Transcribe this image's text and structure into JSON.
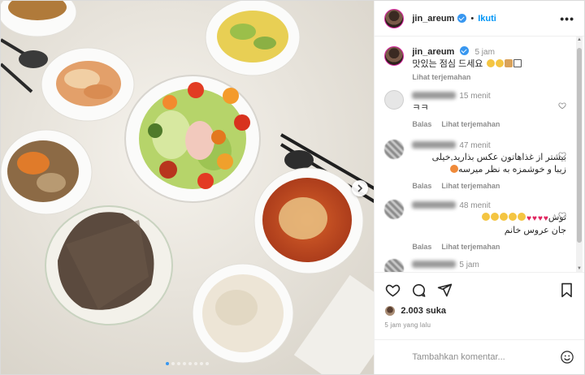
{
  "post": {
    "username": "jin_areum",
    "follow_label": "Ikuti",
    "more_label": "•••",
    "caption": {
      "username": "jin_areum",
      "time": "5 jam",
      "text": "맛있는 점심 드세요",
      "translate_label": "Lihat terjemahan"
    },
    "comments": [
      {
        "time": "15 menit",
        "text": "ㅋㅋ",
        "reply_label": "Balas",
        "translate_label": "Lihat terjemahan"
      },
      {
        "time": "47 menit",
        "text_line1": "بیشتر از غذاهاتون عکس بذارید,خیلی",
        "text_line2": "زیبا و خوشمزه به نظر میرسه",
        "reply_label": "Balas",
        "translate_label": "Lihat terjemahan"
      },
      {
        "time": "48 menit",
        "text_line1": "توش",
        "text_line2": "جان عروس خانم",
        "reply_label": "Balas",
        "translate_label": "Lihat terjemahan"
      },
      {
        "time": "5 jam"
      }
    ],
    "likes": "2.003 suka",
    "posted": "5 jam yang lalu",
    "add_comment_placeholder": "Tambahkan komentar...",
    "carousel": {
      "count": 8,
      "active": 0
    }
  },
  "colors": {
    "link_blue": "#0095f6",
    "verified_blue": "#3897f0",
    "muted_grey": "#8e8e8e"
  },
  "icons": [
    "heart-icon",
    "comment-icon",
    "share-icon",
    "bookmark-icon",
    "emoji-icon",
    "chevron-right-icon",
    "verified-icon"
  ]
}
